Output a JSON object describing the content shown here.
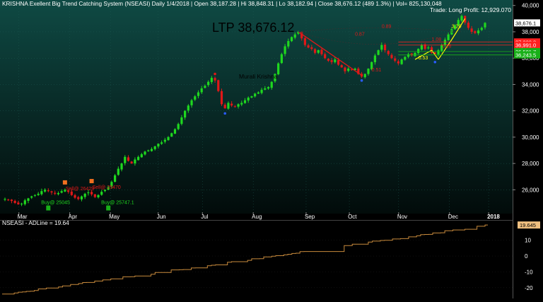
{
  "header": {
    "title": "KRISHNA Exellent Big Trend Catching System (NSEASI) Daily  1/4/2018  |  Open 38,187.28  |  Hi 38,848.31  |  Lo 38,182.94  |  Close 38,676.12 (489 1.3%)  |  Vol= 825,130,048",
    "trade_info": "Trade: Long Profit: 12,929.070"
  },
  "annotations": {
    "ltp": "LTP 38,676.12",
    "author": "Murali Krishna",
    "fib_labels": [
      "0.89",
      "0.87",
      "1.08",
      "0.51",
      "0.53",
      "1.16",
      "3.20"
    ]
  },
  "signals": {
    "sell": [
      "Sell@ 26429",
      "Sell@ 25470"
    ],
    "buy": [
      "Buy@ 25045",
      "Buy@ 25747.1"
    ]
  },
  "colors": {
    "background_top": "#0f4a44",
    "background_bottom": "#020b0a",
    "up": "#1fd81f",
    "down": "#e01818",
    "axis_text": "#ffffff",
    "adline": "#c88a3c",
    "yellow_trend": "#ffff00",
    "price_box": "#ffffff",
    "box_red": "#ff2020",
    "box_green": "#18b018"
  },
  "chart_data": [
    {
      "type": "candlestick",
      "title": "",
      "x_tick_labels": [
        "Mar",
        "Apr",
        "May",
        "Jun",
        "Jul",
        "Aug",
        "Sep",
        "Oct",
        "Nov",
        "Dec",
        "2018"
      ],
      "y_tick_labels": [
        "26,000",
        "28,000",
        "30,000",
        "32,000",
        "34,000",
        "36,000",
        "38,000",
        "40,000"
      ],
      "ylim": [
        24300,
        40200
      ],
      "price_labels": [
        {
          "text": "38,676.1",
          "value": 38676,
          "style": "white"
        },
        {
          "text": "37,232.8",
          "value": 37232,
          "style": "red"
        },
        {
          "text": "36,991.0",
          "value": 36991,
          "style": "red"
        },
        {
          "text": "36,501.7",
          "value": 36501,
          "style": "green"
        },
        {
          "text": "36,243.5",
          "value": 36243,
          "style": "green"
        }
      ],
      "close_series": [
        25300,
        25250,
        25150,
        25000,
        24900,
        24950,
        25200,
        25350,
        25500,
        25600,
        25700,
        25900,
        26000,
        25900,
        25800,
        25700,
        25750,
        25900,
        26000,
        25850,
        25600,
        25400,
        25300,
        25500,
        25700,
        25800,
        25650,
        25450,
        25600,
        25850,
        26000,
        26200,
        26600,
        27100,
        27600,
        28000,
        28500,
        28200,
        28000,
        28300,
        28500,
        28700,
        28900,
        29000,
        29100,
        29300,
        29500,
        29600,
        29800,
        30000,
        30300,
        30600,
        31000,
        31500,
        32000,
        32400,
        32800,
        33100,
        33400,
        33700,
        33900,
        34200,
        34500,
        34300,
        33500,
        32500,
        32200,
        32600,
        32400,
        32300,
        32500,
        32600,
        32800,
        33000,
        33100,
        33300,
        33400,
        33600,
        33700,
        33800,
        34200,
        34800,
        35600,
        36300,
        36900,
        37300,
        37600,
        37800,
        38000,
        37500,
        37000,
        36800,
        36700,
        36400,
        36600,
        36300,
        36000,
        35800,
        35700,
        35900,
        35500,
        35300,
        35000,
        35200,
        35100,
        35200,
        34800,
        34600,
        34800,
        35200,
        35700,
        36200,
        36600,
        37000,
        36600,
        36300,
        36000,
        35800,
        35600,
        35900,
        36100,
        36300,
        36200,
        36400,
        36700,
        37000,
        36700,
        36800,
        36400,
        36300,
        36600,
        37000,
        37400,
        37800,
        38200,
        38500,
        38900,
        39200,
        38700,
        38300,
        38000,
        37900,
        38100,
        38300,
        38676
      ]
    },
    {
      "type": "line",
      "title": "NSEASI - ADLine = 19.64",
      "series": [
        {
          "name": "ADLine",
          "last_value": 19.645
        }
      ],
      "y_tick_labels": [
        "-20",
        "-10",
        "0",
        "10"
      ],
      "ylim": [
        -25,
        19.7
      ],
      "last_value_label": "19.645",
      "start": -24,
      "end": 19.645
    }
  ]
}
